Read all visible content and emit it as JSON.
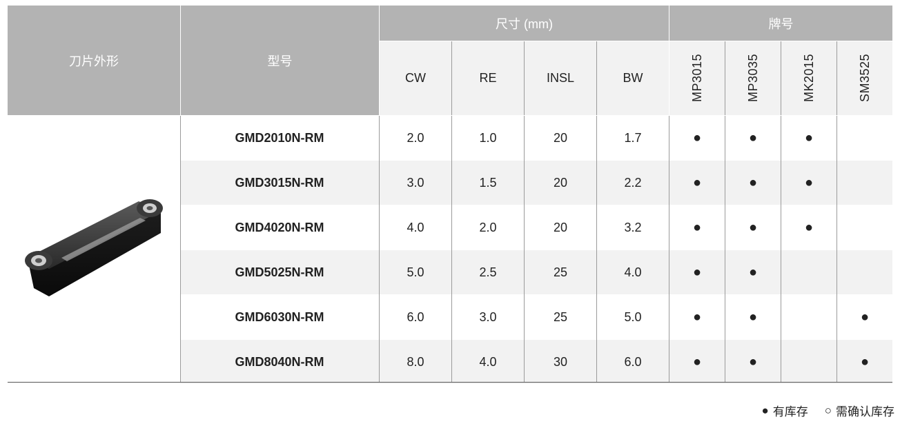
{
  "header": {
    "shape": "刀片外形",
    "model": "型号",
    "dims_group": "尺寸 (mm)",
    "grade_group": "牌号",
    "dims": [
      "CW",
      "RE",
      "INSL",
      "BW"
    ],
    "grades": [
      "MP3015",
      "MP3035",
      "MK2015",
      "SM3525"
    ]
  },
  "rows": [
    {
      "model": "GMD2010N-RM",
      "cw": "2.0",
      "re": "1.0",
      "insl": "20",
      "bw": "1.7",
      "g": [
        "●",
        "●",
        "●",
        ""
      ]
    },
    {
      "model": "GMD3015N-RM",
      "cw": "3.0",
      "re": "1.5",
      "insl": "20",
      "bw": "2.2",
      "g": [
        "●",
        "●",
        "●",
        ""
      ]
    },
    {
      "model": "GMD4020N-RM",
      "cw": "4.0",
      "re": "2.0",
      "insl": "20",
      "bw": "3.2",
      "g": [
        "●",
        "●",
        "●",
        ""
      ]
    },
    {
      "model": "GMD5025N-RM",
      "cw": "5.0",
      "re": "2.5",
      "insl": "25",
      "bw": "4.0",
      "g": [
        "●",
        "●",
        "",
        ""
      ]
    },
    {
      "model": "GMD6030N-RM",
      "cw": "6.0",
      "re": "3.0",
      "insl": "25",
      "bw": "5.0",
      "g": [
        "●",
        "●",
        "",
        "●"
      ]
    },
    {
      "model": "GMD8040N-RM",
      "cw": "8.0",
      "re": "4.0",
      "insl": "30",
      "bw": "6.0",
      "g": [
        "●",
        "●",
        "",
        "●"
      ]
    }
  ],
  "legend": {
    "in_stock_symbol": "●",
    "in_stock": "有库存",
    "confirm_symbol": "○",
    "confirm": "需确认库存"
  },
  "colors": {
    "header_dark": "#b3b3b3",
    "header_light": "#f2f2f2",
    "row_shade": "#f2f2f2"
  },
  "icons": {
    "insert_image": "grooving-insert-image"
  }
}
